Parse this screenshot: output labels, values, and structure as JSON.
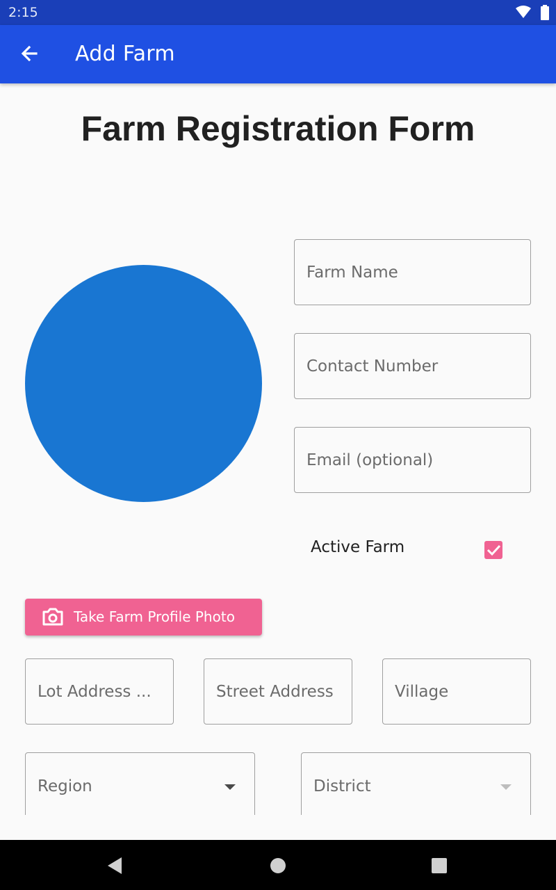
{
  "status_bar": {
    "time": "2:15",
    "icons": [
      "wifi-icon",
      "battery-icon"
    ]
  },
  "app_bar": {
    "title": "Add Farm",
    "back_icon": "arrow-back-icon",
    "color": "#1f50e3"
  },
  "form": {
    "title": "Farm Registration Form",
    "avatar_color": "#1976d2",
    "fields": {
      "farm_name": "Farm Name",
      "contact_number": "Contact Number",
      "email": "Email (optional)",
      "lot_address": "Lot Address ...",
      "street_address": "Street Address",
      "village": "Village",
      "region": "Region",
      "district": "District"
    },
    "active_farm": {
      "label": "Active Farm",
      "checked": true
    },
    "photo_button": {
      "label": "Take Farm Profile Photo",
      "icon": "camera-icon",
      "color": "#f06292"
    }
  },
  "nav_bar": {
    "buttons": [
      "back-triangle-icon",
      "home-circle-icon",
      "recents-square-icon"
    ]
  }
}
